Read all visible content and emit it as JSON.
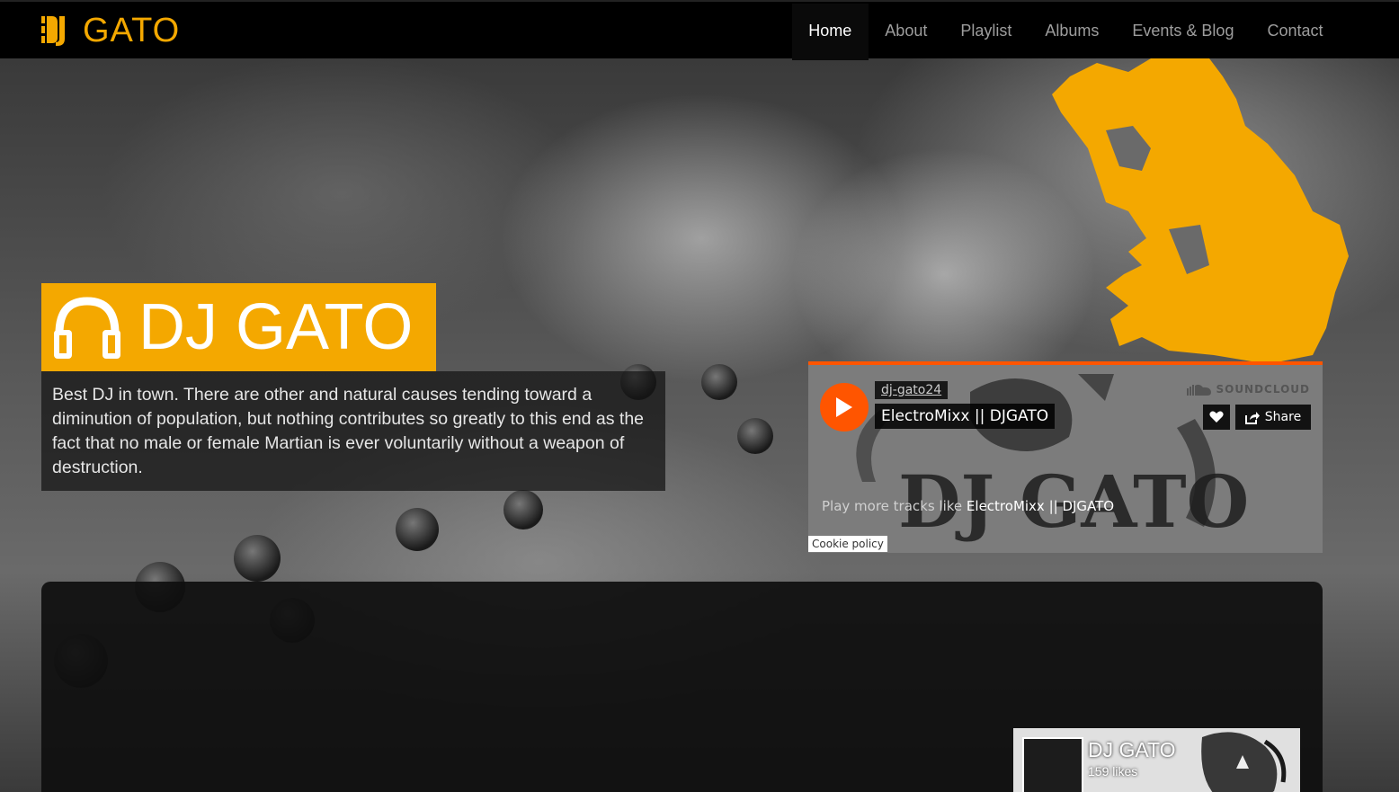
{
  "brand": {
    "name": "GATO",
    "mark": "DJ"
  },
  "nav": {
    "items": [
      {
        "label": "Home",
        "active": true
      },
      {
        "label": "About"
      },
      {
        "label": "Playlist"
      },
      {
        "label": "Albums"
      },
      {
        "label": "Events & Blog"
      },
      {
        "label": "Contact"
      }
    ]
  },
  "hero": {
    "title": "DJ GATO",
    "description": "Best DJ in town. There are other and natural causes tending toward a diminution of population, but nothing contributes so greatly to this end as the fact that no male or female Martian is ever voluntarily without a weapon of destruction."
  },
  "soundcloud": {
    "user": "dj-gato24",
    "track": "ElectroMixx || DJGATO",
    "logo": "SOUNDCLOUD",
    "share_label": "Share",
    "more_prefix": "Play more tracks like ",
    "more_track": "ElectroMixx || DJGATO",
    "cookie": "Cookie policy"
  },
  "facebook": {
    "name": "DJ GATO",
    "likes": "159 likes"
  },
  "colors": {
    "accent": "#f4a800",
    "soundcloud": "#ff5500"
  }
}
